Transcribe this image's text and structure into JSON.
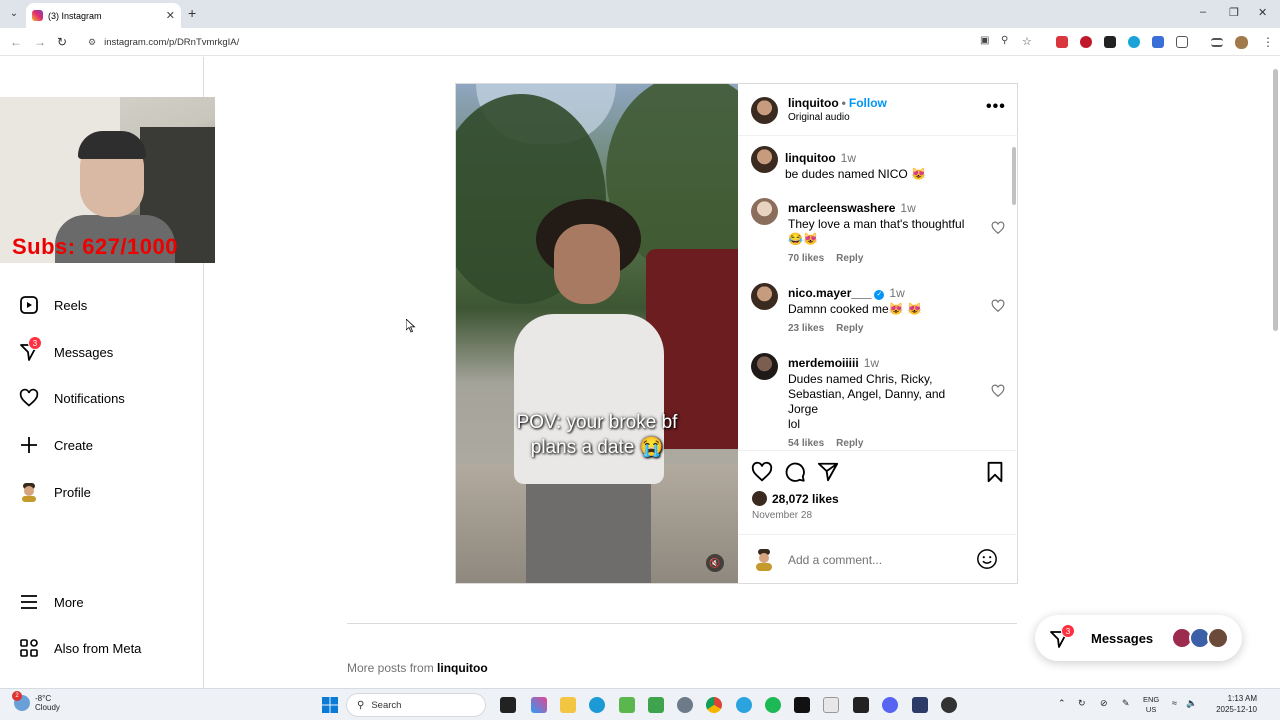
{
  "browser": {
    "tab_title": "(3) Instagram",
    "url": "instagram.com/p/DRnTvmrkgIA/"
  },
  "webcam_overlay": {
    "subs_text": "Subs: 627/1000"
  },
  "sidebar": {
    "items": [
      {
        "label": "Reels",
        "icon": "reels-icon"
      },
      {
        "label": "Messages",
        "icon": "messenger-icon",
        "badge": "3"
      },
      {
        "label": "Notifications",
        "icon": "heart-icon"
      },
      {
        "label": "Create",
        "icon": "plus-icon"
      },
      {
        "label": "Profile",
        "icon": "avatar"
      },
      {
        "label": "More",
        "icon": "menu-icon"
      },
      {
        "label": "Also from Meta",
        "icon": "meta-grid-icon"
      }
    ]
  },
  "post": {
    "video_caption_line1": "POV: your broke bf",
    "video_caption_line2": "plans a date 😭",
    "author": "linquitoo",
    "follow_label": "Follow",
    "audio": "Original audio",
    "caption": {
      "user": "linquitoo",
      "time": "1w",
      "text": "be dudes named NICO 😻"
    },
    "comments": [
      {
        "user": "marcleenswashere",
        "time": "1w",
        "text_line1": "They love a man that's thoughtful",
        "text_line2": "😂😻",
        "likes": "70 likes",
        "reply": "Reply"
      },
      {
        "user": "nico.mayer___",
        "time": "1w",
        "text_line1": "Damnn cooked me😻 😻",
        "likes": "23 likes",
        "reply": "Reply",
        "verified": true
      },
      {
        "user": "merdemoiiiii",
        "time": "1w",
        "text_line1": "Dudes named Chris, Ricky,",
        "text_line2": "Sebastian, Angel, Danny, and Jorge",
        "text_line3": "lol",
        "likes": "54 likes",
        "reply": "Reply"
      }
    ],
    "likes_count": "28,072 likes",
    "date": "November 28",
    "add_comment_placeholder": "Add a comment..."
  },
  "more_posts": {
    "prefix": "More posts from",
    "user": "linquitoo"
  },
  "messages_pill": {
    "label": "Messages",
    "badge": "3"
  },
  "taskbar": {
    "temp": "-8°C",
    "condition": "Cloudy",
    "weather_badge": "2",
    "search": "Search",
    "lang1": "ENG",
    "lang2": "US",
    "time": "1:13 AM",
    "date": "2025-12-10"
  },
  "colors": {
    "accent": "#0095f6",
    "badge": "#ff3040",
    "subs_red": "#ee0000"
  }
}
